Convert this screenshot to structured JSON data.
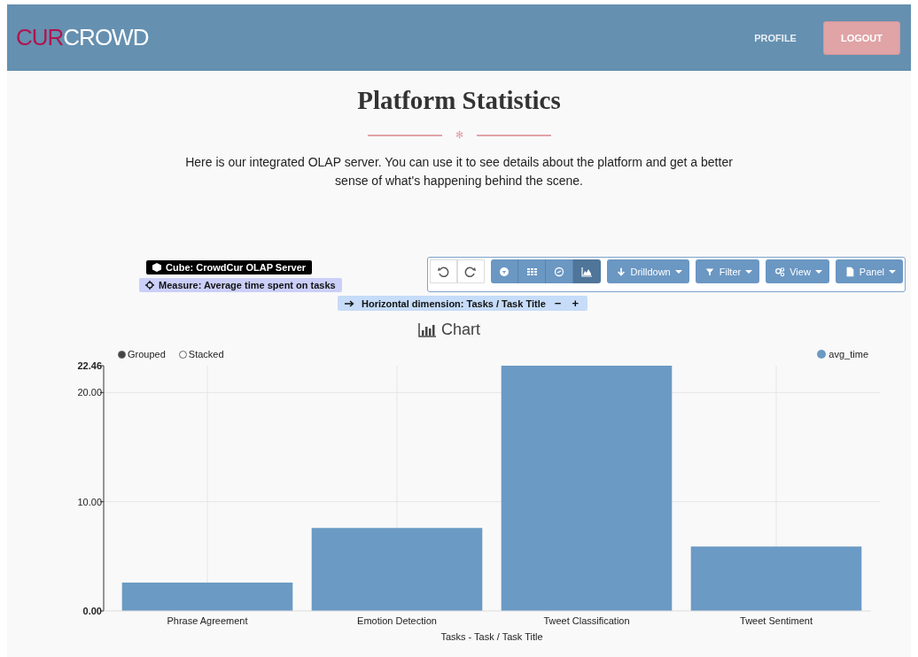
{
  "header": {
    "logo": {
      "accent": "CUR",
      "text": "CROWD"
    },
    "nav": [
      {
        "label": "PROFILE",
        "kind": "link"
      },
      {
        "label": "LOGOUT",
        "kind": "button"
      }
    ]
  },
  "page": {
    "title": "Platform Statistics",
    "ornament": "✻",
    "intro": "Here is our integrated OLAP server. You can use it to see details about the platform and get a better sense of what's happening behind the scene."
  },
  "olap": {
    "cube": "Cube: CrowdCur OLAP Server",
    "measure": "Measure: Average time spent on tasks",
    "dimension": {
      "label": "Horizontal dimension: Tasks / Task Title",
      "minus": "−",
      "plus": "+"
    },
    "history": [
      {
        "kind": "undo"
      },
      {
        "kind": "redo"
      }
    ],
    "views": [
      {
        "kind": "export",
        "selected": false
      },
      {
        "kind": "table",
        "selected": false
      },
      {
        "kind": "gauge",
        "selected": false
      },
      {
        "kind": "chart",
        "selected": true
      }
    ],
    "menus": [
      {
        "kind": "drilldown",
        "label": "Drilldown"
      },
      {
        "kind": "filter",
        "label": "Filter"
      },
      {
        "kind": "view",
        "label": "View"
      },
      {
        "kind": "panel",
        "label": "Panel"
      }
    ]
  },
  "chart": {
    "title": "Chart",
    "modes": [
      {
        "label": "Grouped",
        "selected": true
      },
      {
        "label": "Stacked",
        "selected": false
      }
    ],
    "chart_data": {
      "type": "bar",
      "xlabel": "Tasks - Task / Task Title",
      "categories": [
        "Phrase Agreement",
        "Emotion Detection",
        "Tweet Classification",
        "Tweet Sentiment"
      ],
      "series": [
        {
          "name": "avg_time",
          "color": "#6b9ac4",
          "values": [
            2.6,
            7.6,
            22.46,
            5.9
          ]
        }
      ],
      "grid": true,
      "ylim": [
        0,
        22.46
      ],
      "yticks": [
        {
          "value": 0,
          "label": "0.00"
        },
        {
          "value": 10,
          "label": "10.00"
        },
        {
          "value": 20,
          "label": "20.00"
        },
        {
          "value": 22.46,
          "label": "22.46"
        }
      ]
    }
  }
}
